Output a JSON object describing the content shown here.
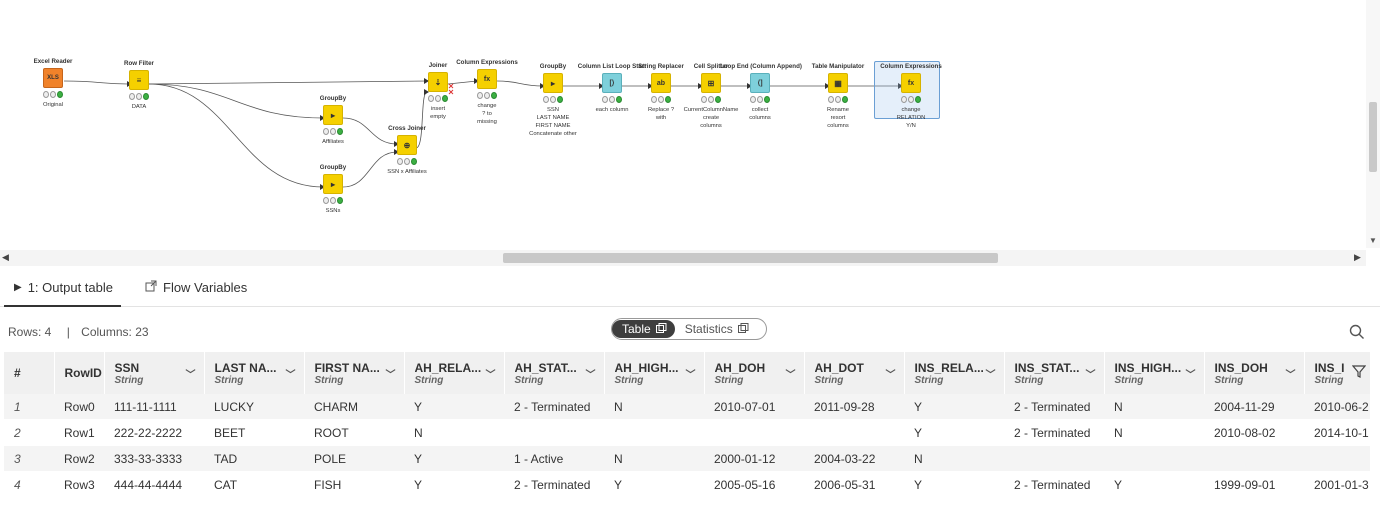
{
  "workflow": {
    "nodes": {
      "excel_reader": {
        "title": "Excel Reader",
        "label": "Original",
        "icon": "XLS"
      },
      "row_filter": {
        "title": "Row Filter",
        "label": "DATA",
        "icon": "≡"
      },
      "groupby_affiliates": {
        "title": "GroupBy",
        "label": "Affiliates",
        "icon": "▸"
      },
      "groupby_ssns": {
        "title": "GroupBy",
        "label": "SSNs",
        "icon": "▸"
      },
      "cross_joiner": {
        "title": "Cross Joiner",
        "label": "SSN x Affiliates",
        "icon": "⊕"
      },
      "joiner": {
        "title": "Joiner",
        "label": "insert\nempty",
        "icon": "⇣"
      },
      "column_expressions_1": {
        "title": "Column Expressions",
        "label": "change\n? to\nmissing",
        "icon": "fx"
      },
      "groupby_ssn": {
        "title": "GroupBy",
        "label": "SSN\nLAST NAME\nFIRST NAME\nConcatenate other",
        "icon": "▸"
      },
      "column_list_loop_start": {
        "title": "Column List Loop Start",
        "label": "each column",
        "icon": "[⟩"
      },
      "string_replacer": {
        "title": "String Replacer",
        "label": "Replace ?\nwith",
        "icon": "ab"
      },
      "cell_splitter": {
        "title": "Cell Splitter",
        "label": "CurrentColumnName\ncreate\ncolumns",
        "icon": "⊞"
      },
      "loop_end": {
        "title": "Loop End (Column Append)",
        "label": "collect\ncolumns",
        "icon": "⟨]"
      },
      "table_manipulator": {
        "title": "Table Manipulator",
        "label": "Rename\nresort\ncolumns",
        "icon": "▦"
      },
      "column_expressions_2": {
        "title": "Column Expressions",
        "label": "change\nRELATION\nY/N",
        "icon": "fx"
      }
    }
  },
  "tabs": {
    "output_table": "1: Output table",
    "flow_variables": "Flow Variables"
  },
  "info": {
    "rows": "Rows: 4",
    "separator": "|",
    "columns": "Columns: 23"
  },
  "view_switch": {
    "table": "Table",
    "statistics": "Statistics"
  },
  "table": {
    "index_header": "#",
    "columns": [
      {
        "name": "RowID",
        "type": ""
      },
      {
        "name": "SSN",
        "type": "String"
      },
      {
        "name": "LAST NA...",
        "type": "String"
      },
      {
        "name": "FIRST NA...",
        "type": "String"
      },
      {
        "name": "AH_RELA...",
        "type": "String"
      },
      {
        "name": "AH_STAT...",
        "type": "String"
      },
      {
        "name": "AH_HIGH...",
        "type": "String"
      },
      {
        "name": "AH_DOH",
        "type": "String"
      },
      {
        "name": "AH_DOT",
        "type": "String"
      },
      {
        "name": "INS_RELA...",
        "type": "String"
      },
      {
        "name": "INS_STAT...",
        "type": "String"
      },
      {
        "name": "INS_HIGH...",
        "type": "String"
      },
      {
        "name": "INS_DOH",
        "type": "String"
      },
      {
        "name": "INS_I",
        "type": "String"
      }
    ],
    "rows": [
      {
        "index": "1",
        "cells": [
          "Row0",
          "111-11-1111",
          "LUCKY",
          "CHARM",
          "Y",
          "2 - Terminated",
          "N",
          "2010-07-01",
          "2011-09-28",
          "Y",
          "2 - Terminated",
          "N",
          "2004-11-29",
          "2010-06-2"
        ]
      },
      {
        "index": "2",
        "cells": [
          "Row1",
          "222-22-2222",
          "BEET",
          "ROOT",
          "N",
          "",
          "",
          "",
          "",
          "Y",
          "2 - Terminated",
          "N",
          "2010-08-02",
          "2014-10-1"
        ]
      },
      {
        "index": "3",
        "cells": [
          "Row2",
          "333-33-3333",
          "TAD",
          "POLE",
          "Y",
          "1 - Active",
          "N",
          "2000-01-12",
          "2004-03-22",
          "N",
          "",
          "",
          "",
          ""
        ]
      },
      {
        "index": "4",
        "cells": [
          "Row3",
          "444-44-4444",
          "CAT",
          "FISH",
          "Y",
          "2 - Terminated",
          "Y",
          "2005-05-16",
          "2006-05-31",
          "Y",
          "2 - Terminated",
          "Y",
          "1999-09-01",
          "2001-01-3"
        ]
      }
    ]
  },
  "colors": {
    "node_yellow": "#f5d000",
    "node_orange": "#f0822a",
    "node_teal": "#7ed0db",
    "status_green": "#3cb043",
    "selection_blue": "#6b9fd4"
  }
}
